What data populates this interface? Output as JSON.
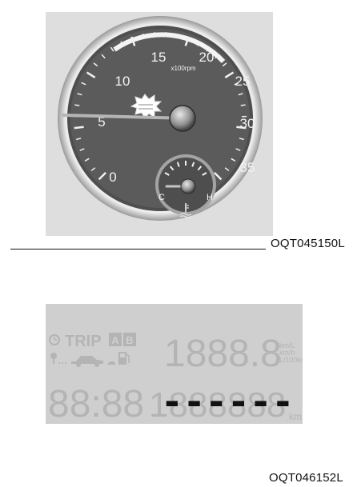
{
  "tachometer": {
    "scale_labels": [
      "0",
      "5",
      "10",
      "15",
      "20",
      "25",
      "30",
      "35"
    ],
    "unit_label": "x100rpm",
    "needle_value": 5,
    "temp_gauge": {
      "cold_label": "C",
      "hot_label": "H"
    },
    "figure_code": "OQT045150L"
  },
  "lcd_display": {
    "trip_label": "TRIP",
    "trip_a": "A",
    "trip_b": "B",
    "segment_top": "1888.8",
    "segment_clock": "88:88",
    "segment_odometer": "1888888",
    "odometer_dashes": "------",
    "unit_km_per_l": "km/L",
    "unit_km_per_h": "km/h",
    "unit_l_per_100km": "L/100km",
    "unit_km": "km",
    "figure_code": "OQT046152L"
  },
  "colors": {
    "dial_face": "#5a5a5a",
    "bezel": "#c8c8c8",
    "needle": "#b0b0b0",
    "lcd_background": "#cfcfcf",
    "lcd_segments_dim": "#b4b4b4",
    "lcd_dashes_active": "#111111"
  }
}
